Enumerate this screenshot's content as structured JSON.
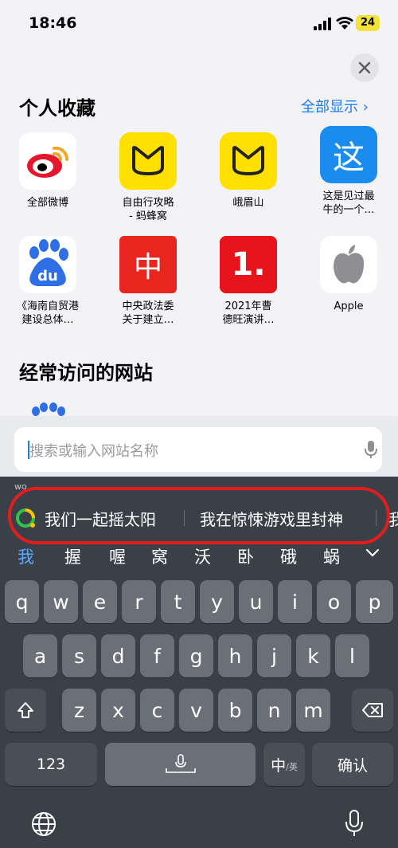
{
  "status": {
    "time": "18:46",
    "battery": "24"
  },
  "favorites": {
    "title": "个人收藏",
    "show_all": "全部显示 ›",
    "items": [
      {
        "label": "全部微博",
        "icon": "weibo-icon"
      },
      {
        "label": "自由行攻略\n- 蚂蜂窝",
        "icon": "mafengwo-icon"
      },
      {
        "label": "峨眉山",
        "icon": "mafengwo-icon"
      },
      {
        "label": "这是见过最\n牛的一个…",
        "icon_text": "这",
        "icon": "zhe-icon"
      },
      {
        "label": "《海南自贸港\n建设总体…",
        "icon": "baidu-icon"
      },
      {
        "label": "中央政法委\n关于建立…",
        "icon_text": "中",
        "icon": "zhong-icon"
      },
      {
        "label": "2021年曹\n德旺演讲…",
        "icon_text": "1.",
        "icon": "one-icon"
      },
      {
        "label": "Apple",
        "icon": "apple-icon"
      }
    ]
  },
  "frequent": {
    "title": "经常访问的网站"
  },
  "search": {
    "placeholder": "搜索或输入网站名称"
  },
  "ime": {
    "pinyin": "wo",
    "suggestions": [
      "我们一起摇太阳",
      "我在惊悚游戏里封神",
      "我"
    ],
    "candidates": [
      "我",
      "握",
      "喔",
      "窝",
      "沃",
      "卧",
      "硪",
      "蜗"
    ],
    "rows": [
      [
        "q",
        "w",
        "e",
        "r",
        "t",
        "y",
        "u",
        "i",
        "o",
        "p"
      ],
      [
        "a",
        "s",
        "d",
        "f",
        "g",
        "h",
        "j",
        "k",
        "l"
      ],
      [
        "z",
        "x",
        "c",
        "v",
        "b",
        "n",
        "m"
      ]
    ],
    "key_123": "123",
    "key_lang": "中",
    "key_lang_sub": "/英",
    "key_confirm": "确认"
  }
}
